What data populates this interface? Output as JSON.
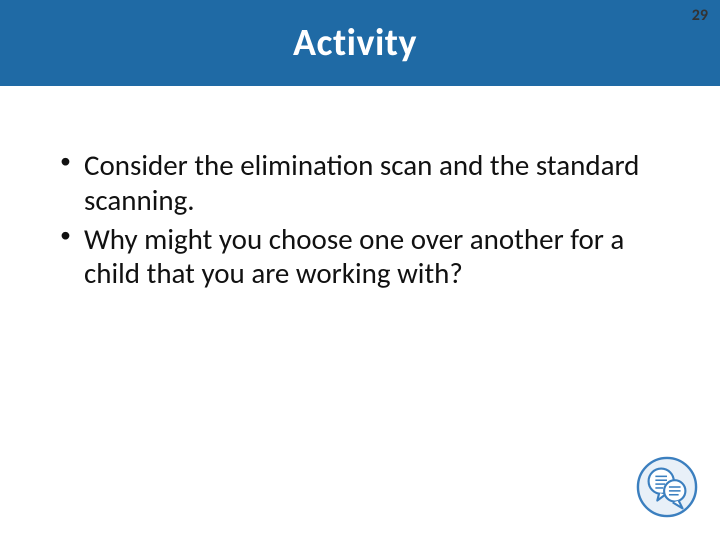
{
  "slide": {
    "page_number": "29",
    "title": "Activity",
    "bullets": [
      "Consider the elimination scan and the standard scanning.",
      "Why might you choose one over another for a child that you are working with?"
    ]
  },
  "colors": {
    "header_bg": "#1f6aa5",
    "icon_stroke": "#3b7fbf"
  }
}
